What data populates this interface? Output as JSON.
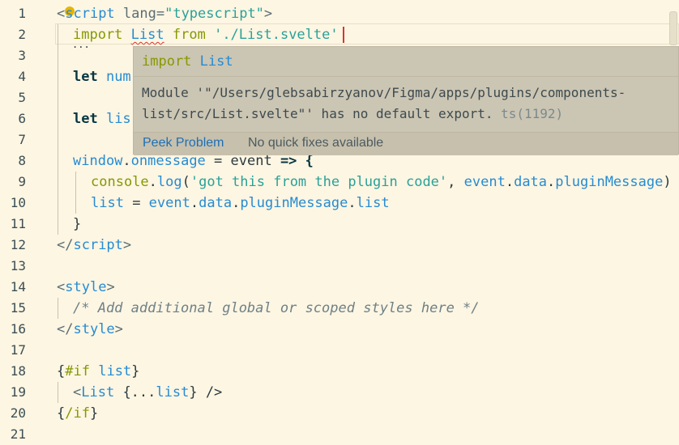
{
  "editor": {
    "line_numbers": [
      "1",
      "2",
      "3",
      "4",
      "5",
      "6",
      "7",
      "8",
      "9",
      "10",
      "11",
      "12",
      "13",
      "14",
      "15",
      "16",
      "17",
      "18",
      "19",
      "20",
      "21"
    ],
    "lines": {
      "l1": [
        "<",
        "script",
        " lang=",
        "\"typescript\"",
        ">"
      ],
      "l2": [
        "import",
        " ",
        "List",
        " ",
        "from",
        " ",
        "'./List.svelte'"
      ],
      "l4": [
        "let",
        " num"
      ],
      "l6": [
        "let",
        " lis"
      ],
      "l8": [
        "window",
        ".",
        "onmessage",
        " = ",
        "event",
        " => {"
      ],
      "l9": [
        "console",
        ".",
        "log",
        "(",
        "'got this from the plugin code'",
        ", ",
        "event",
        ".",
        "data",
        ".",
        "pluginMessage",
        ")"
      ],
      "l10": [
        "list",
        " = ",
        "event",
        ".",
        "data",
        ".",
        "pluginMessage",
        ".",
        "list"
      ],
      "l11": [
        "}"
      ],
      "l12": [
        "</",
        "script",
        ">"
      ],
      "l14": [
        "<",
        "style",
        ">"
      ],
      "l15": [
        "/* Add additional global or scoped styles here */"
      ],
      "l16": [
        "</",
        "style",
        ">"
      ],
      "l18": [
        "{",
        "#if",
        " ",
        "list",
        "}"
      ],
      "l19": [
        "<",
        "List",
        " {...",
        "list",
        "} />"
      ],
      "l20": [
        "{",
        "/if",
        "}"
      ]
    },
    "fold_dots": "..."
  },
  "hover": {
    "signature_keyword": "import",
    "signature_name": "List",
    "message": "Module '\"/Users/glebsabirzyanov/Figma/apps/plugins/components-list/src/List.svelte\"' has no default export.",
    "code": "ts(1192)",
    "peek_label": "Peek Problem",
    "no_fix_label": "No quick fixes available"
  },
  "colors": {
    "background": "#fdf6e3",
    "keyword": "#859900",
    "tag": "#268bd2",
    "string": "#2aa198",
    "error": "#dc322f",
    "hover_bg": "#cbc5b3"
  },
  "icons": [
    "lightbulb-icon"
  ]
}
